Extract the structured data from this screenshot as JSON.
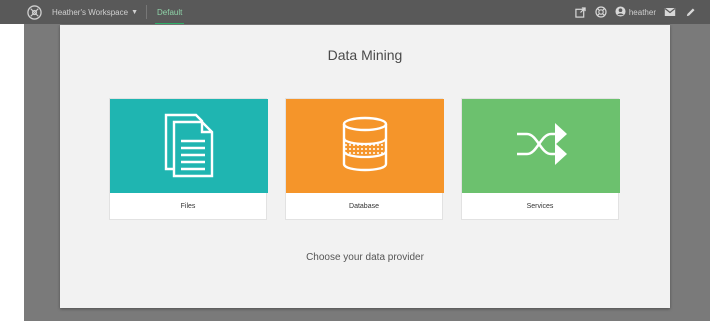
{
  "header": {
    "workspace_label": "Heather's Workspace",
    "tab_label": "Default",
    "username": "heather",
    "icons": [
      "app-logo-icon",
      "chevron-down-icon",
      "share-icon",
      "help-icon",
      "user-icon",
      "mail-icon",
      "edit-icon"
    ]
  },
  "modal": {
    "title": "Data Mining",
    "prompt": "Choose your data provider",
    "providers": [
      {
        "label": "Files",
        "color": "#1fb5b1",
        "icon": "files-icon"
      },
      {
        "label": "Database",
        "color": "#f5952a",
        "icon": "database-icon"
      },
      {
        "label": "Services",
        "color": "#6cc16e",
        "icon": "shuffle-icon"
      }
    ]
  },
  "colors": {
    "topbar": "#595959",
    "backdrop": "#7a7a7a",
    "modal_bg": "#f2f2f2",
    "tab_accent": "#2fb36b"
  }
}
